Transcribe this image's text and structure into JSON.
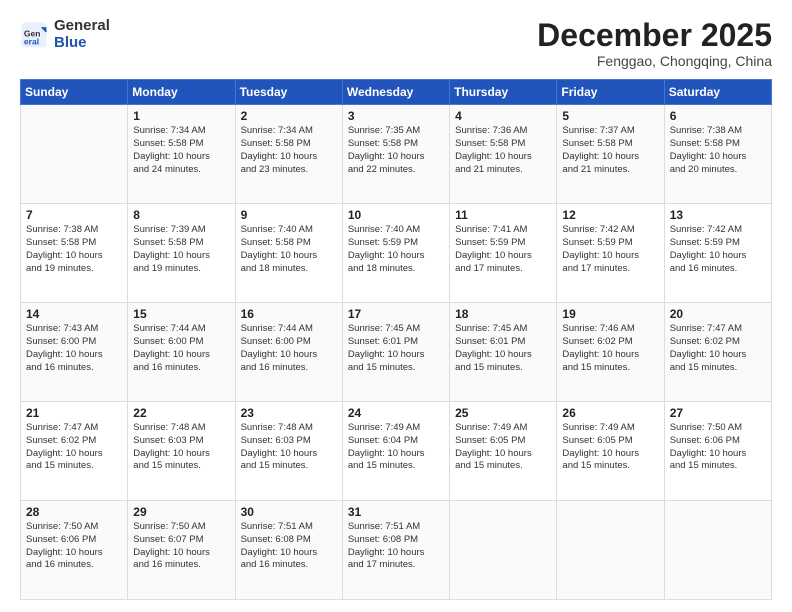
{
  "header": {
    "logo_general": "General",
    "logo_blue": "Blue",
    "month": "December 2025",
    "location": "Fenggao, Chongqing, China"
  },
  "weekdays": [
    "Sunday",
    "Monday",
    "Tuesday",
    "Wednesday",
    "Thursday",
    "Friday",
    "Saturday"
  ],
  "weeks": [
    [
      {
        "day": "",
        "info": ""
      },
      {
        "day": "1",
        "info": "Sunrise: 7:34 AM\nSunset: 5:58 PM\nDaylight: 10 hours\nand 24 minutes."
      },
      {
        "day": "2",
        "info": "Sunrise: 7:34 AM\nSunset: 5:58 PM\nDaylight: 10 hours\nand 23 minutes."
      },
      {
        "day": "3",
        "info": "Sunrise: 7:35 AM\nSunset: 5:58 PM\nDaylight: 10 hours\nand 22 minutes."
      },
      {
        "day": "4",
        "info": "Sunrise: 7:36 AM\nSunset: 5:58 PM\nDaylight: 10 hours\nand 21 minutes."
      },
      {
        "day": "5",
        "info": "Sunrise: 7:37 AM\nSunset: 5:58 PM\nDaylight: 10 hours\nand 21 minutes."
      },
      {
        "day": "6",
        "info": "Sunrise: 7:38 AM\nSunset: 5:58 PM\nDaylight: 10 hours\nand 20 minutes."
      }
    ],
    [
      {
        "day": "7",
        "info": "Sunrise: 7:38 AM\nSunset: 5:58 PM\nDaylight: 10 hours\nand 19 minutes."
      },
      {
        "day": "8",
        "info": "Sunrise: 7:39 AM\nSunset: 5:58 PM\nDaylight: 10 hours\nand 19 minutes."
      },
      {
        "day": "9",
        "info": "Sunrise: 7:40 AM\nSunset: 5:58 PM\nDaylight: 10 hours\nand 18 minutes."
      },
      {
        "day": "10",
        "info": "Sunrise: 7:40 AM\nSunset: 5:59 PM\nDaylight: 10 hours\nand 18 minutes."
      },
      {
        "day": "11",
        "info": "Sunrise: 7:41 AM\nSunset: 5:59 PM\nDaylight: 10 hours\nand 17 minutes."
      },
      {
        "day": "12",
        "info": "Sunrise: 7:42 AM\nSunset: 5:59 PM\nDaylight: 10 hours\nand 17 minutes."
      },
      {
        "day": "13",
        "info": "Sunrise: 7:42 AM\nSunset: 5:59 PM\nDaylight: 10 hours\nand 16 minutes."
      }
    ],
    [
      {
        "day": "14",
        "info": "Sunrise: 7:43 AM\nSunset: 6:00 PM\nDaylight: 10 hours\nand 16 minutes."
      },
      {
        "day": "15",
        "info": "Sunrise: 7:44 AM\nSunset: 6:00 PM\nDaylight: 10 hours\nand 16 minutes."
      },
      {
        "day": "16",
        "info": "Sunrise: 7:44 AM\nSunset: 6:00 PM\nDaylight: 10 hours\nand 16 minutes."
      },
      {
        "day": "17",
        "info": "Sunrise: 7:45 AM\nSunset: 6:01 PM\nDaylight: 10 hours\nand 15 minutes."
      },
      {
        "day": "18",
        "info": "Sunrise: 7:45 AM\nSunset: 6:01 PM\nDaylight: 10 hours\nand 15 minutes."
      },
      {
        "day": "19",
        "info": "Sunrise: 7:46 AM\nSunset: 6:02 PM\nDaylight: 10 hours\nand 15 minutes."
      },
      {
        "day": "20",
        "info": "Sunrise: 7:47 AM\nSunset: 6:02 PM\nDaylight: 10 hours\nand 15 minutes."
      }
    ],
    [
      {
        "day": "21",
        "info": "Sunrise: 7:47 AM\nSunset: 6:02 PM\nDaylight: 10 hours\nand 15 minutes."
      },
      {
        "day": "22",
        "info": "Sunrise: 7:48 AM\nSunset: 6:03 PM\nDaylight: 10 hours\nand 15 minutes."
      },
      {
        "day": "23",
        "info": "Sunrise: 7:48 AM\nSunset: 6:03 PM\nDaylight: 10 hours\nand 15 minutes."
      },
      {
        "day": "24",
        "info": "Sunrise: 7:49 AM\nSunset: 6:04 PM\nDaylight: 10 hours\nand 15 minutes."
      },
      {
        "day": "25",
        "info": "Sunrise: 7:49 AM\nSunset: 6:05 PM\nDaylight: 10 hours\nand 15 minutes."
      },
      {
        "day": "26",
        "info": "Sunrise: 7:49 AM\nSunset: 6:05 PM\nDaylight: 10 hours\nand 15 minutes."
      },
      {
        "day": "27",
        "info": "Sunrise: 7:50 AM\nSunset: 6:06 PM\nDaylight: 10 hours\nand 15 minutes."
      }
    ],
    [
      {
        "day": "28",
        "info": "Sunrise: 7:50 AM\nSunset: 6:06 PM\nDaylight: 10 hours\nand 16 minutes."
      },
      {
        "day": "29",
        "info": "Sunrise: 7:50 AM\nSunset: 6:07 PM\nDaylight: 10 hours\nand 16 minutes."
      },
      {
        "day": "30",
        "info": "Sunrise: 7:51 AM\nSunset: 6:08 PM\nDaylight: 10 hours\nand 16 minutes."
      },
      {
        "day": "31",
        "info": "Sunrise: 7:51 AM\nSunset: 6:08 PM\nDaylight: 10 hours\nand 17 minutes."
      },
      {
        "day": "",
        "info": ""
      },
      {
        "day": "",
        "info": ""
      },
      {
        "day": "",
        "info": ""
      }
    ]
  ]
}
